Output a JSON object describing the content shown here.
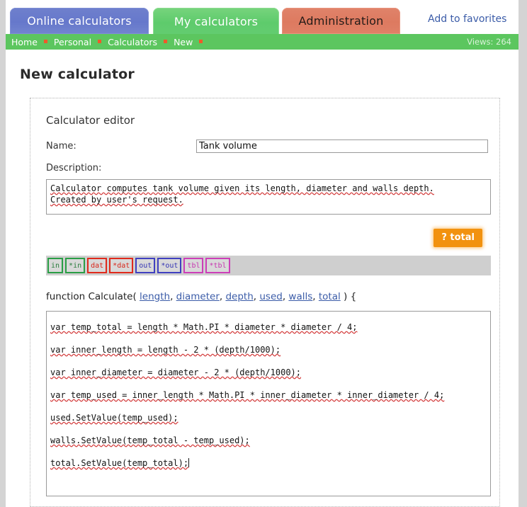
{
  "tabs": [
    {
      "id": "online",
      "label": "Online calculators",
      "active": false
    },
    {
      "id": "my",
      "label": "My calculators",
      "active": true
    },
    {
      "id": "admin",
      "label": "Administration",
      "active": false
    }
  ],
  "favorites_link": "Add to favorites",
  "breadcrumb": {
    "items": [
      "Home",
      "Personal",
      "Calculators",
      "New"
    ],
    "views_label": "Views: 264"
  },
  "page_title": "New calculator",
  "editor": {
    "title": "Calculator editor",
    "name_label": "Name:",
    "name_value": "Tank volume",
    "name_placeholder": "",
    "description_label": "Description:",
    "description_value": "Calculator computes tank volume given its length, diameter and walls depth.\nCreated by user's request.",
    "description_lines": [
      "Calculator computes tank volume given its length, diameter and walls depth.",
      "Created by user's request."
    ],
    "total_button": "? total",
    "var_buttons": [
      {
        "label": "in",
        "kind": "in"
      },
      {
        "label": "*in",
        "kind": "in"
      },
      {
        "label": "dat",
        "kind": "dat"
      },
      {
        "label": "*dat",
        "kind": "dat"
      },
      {
        "label": "out",
        "kind": "out"
      },
      {
        "label": "*out",
        "kind": "out"
      },
      {
        "label": "tbl",
        "kind": "tbl"
      },
      {
        "label": "*tbl",
        "kind": "tbl"
      }
    ],
    "function_prefix": "function Calculate( ",
    "function_params": [
      "length",
      "diameter",
      "depth",
      "used",
      "walls",
      "total"
    ],
    "function_suffix": " ) {",
    "code_lines": [
      "var temp_total = length * Math.PI * diameter * diameter / 4;",
      "var inner_length = length - 2 * (depth/1000);",
      "var inner_diameter = diameter - 2 * (depth/1000);",
      "var temp_used = inner_length * Math.PI * inner_diameter * inner_diameter / 4;",
      "used.SetValue(temp_used);",
      "walls.SetValue(temp_total - temp_used);",
      "total.SetValue(temp_total);"
    ]
  },
  "colors": {
    "nav_green": "#5cc65f",
    "tab_blue": "#6678cb",
    "tab_green": "#5ecb6c",
    "tab_salmon": "#dd7a60",
    "accent_orange": "#f2920f",
    "crumb_sep": "#ef5a2a",
    "link_blue": "#3b5ca8",
    "page_bg": "#d4d4d4"
  }
}
